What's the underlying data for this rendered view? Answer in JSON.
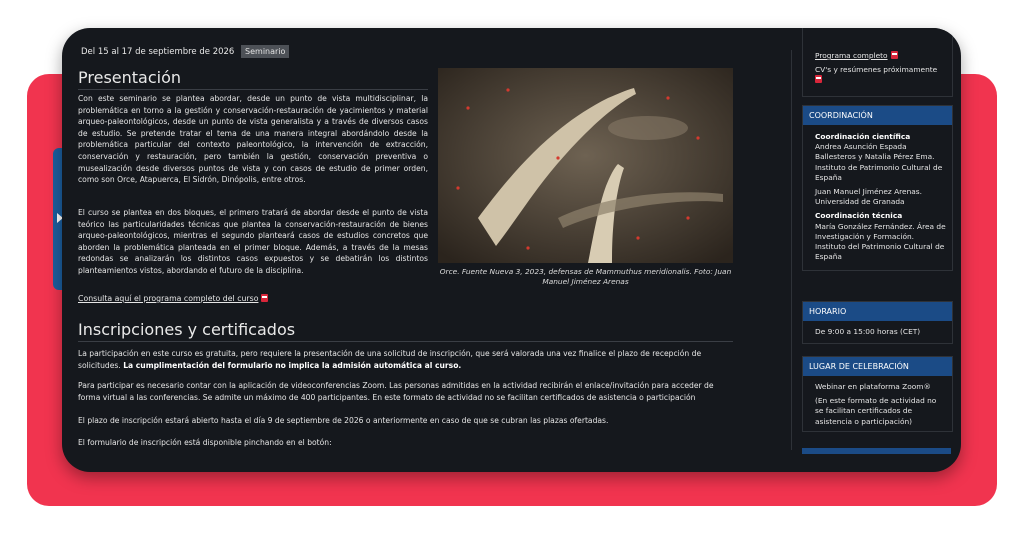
{
  "header": {
    "date": "Del 15 al 17 de septiembre de 2026",
    "badge": "Seminario"
  },
  "presentacion": {
    "title": "Presentación",
    "p1": "Con este seminario se plantea abordar, desde un punto de vista multidisciplinar, la problemática en torno a la gestión y conservación-restauración de yacimientos y material arqueo-paleontológicos, desde un punto de vista generalista y a través de diversos casos de estudio. Se pretende tratar el tema de una manera integral abordándolo desde la problemática particular del contexto paleontológico, la intervención de extracción, conservación y restauración, pero también la gestión, conservación preventiva o musealización desde diversos puntos de vista y con casos de estudio de primer orden, como son Orce, Atapuerca, El Sidrón, Dinópolis, entre otros.",
    "p2": "El curso se plantea en dos bloques, el primero tratará de abordar desde el punto de vista teórico las particularidades técnicas que plantea la conservación-restauración de bienes arqueo-paleontológicos, mientras el segundo planteará casos de estudios concretos que aborden la problemática planteada en el primer bloque. Además, a través de la mesas redondas se analizarán los distintos casos expuestos y se debatirán los distintos planteamientos vistos, abordando el futuro de la disciplina.",
    "link": "Consulta aquí el programa completo del curso",
    "caption": "Orce. Fuente Nueva 3, 2023, defensas de Mammuthus meridionalis. Foto: Juan Manuel Jiménez Arenas"
  },
  "inscripciones": {
    "title": "Inscripciones y certificados",
    "p1_a": "La participación en este curso es gratuita, pero requiere la presentación de una solicitud de inscripción, que será valorada una vez finalice el plazo de recepción de solicitudes.",
    "p1_b": "La cumplimentación del formulario no implica la admisión automática al curso.",
    "p2": "Para participar es necesario contar con la aplicación de videoconferencias Zoom. Las personas admitidas en la actividad recibirán el enlace/invitación para acceder de forma virtual a las conferencias. Se admite un máximo de 400 participantes. En este formato de actividad no se facilitan certificados de asistencia o participación",
    "p3": "El plazo de inscripción estará abierto hasta el día 9 de septiembre de 2026 o anteriormente en caso de que se cubran las plazas ofertadas.",
    "p4": "El formulario de inscripción está disponible pinchando en el botón:"
  },
  "sidebar": {
    "programa_link": "Programa completo",
    "cvs": "CV's y resúmenes próximamente",
    "coordinacion": {
      "title": "COORDINACIÓN",
      "cientifica_title": "Coordinación científica",
      "cientifica_1": "Andrea Asunción Espada Ballesteros y Natalia Pérez Ema. Instituto de Patrimonio Cultural de España",
      "cientifica_2": "Juan Manuel Jiménez Arenas. Universidad de Granada",
      "tecnica_title": "Coordinación técnica",
      "tecnica_1": "María González Fernández. Área de Investigación y Formación. Instituto del Patrimonio Cultural de España"
    },
    "horario": {
      "title": "HORARIO",
      "text": "De 9:00 a 15:00 horas (CET)"
    },
    "lugar": {
      "title": "LUGAR DE CELEBRACIÓN",
      "text1": "Webinar en plataforma Zoom®",
      "text2": "(En este formato de actividad no se facilitan certificados de asistencia o participación)"
    }
  }
}
